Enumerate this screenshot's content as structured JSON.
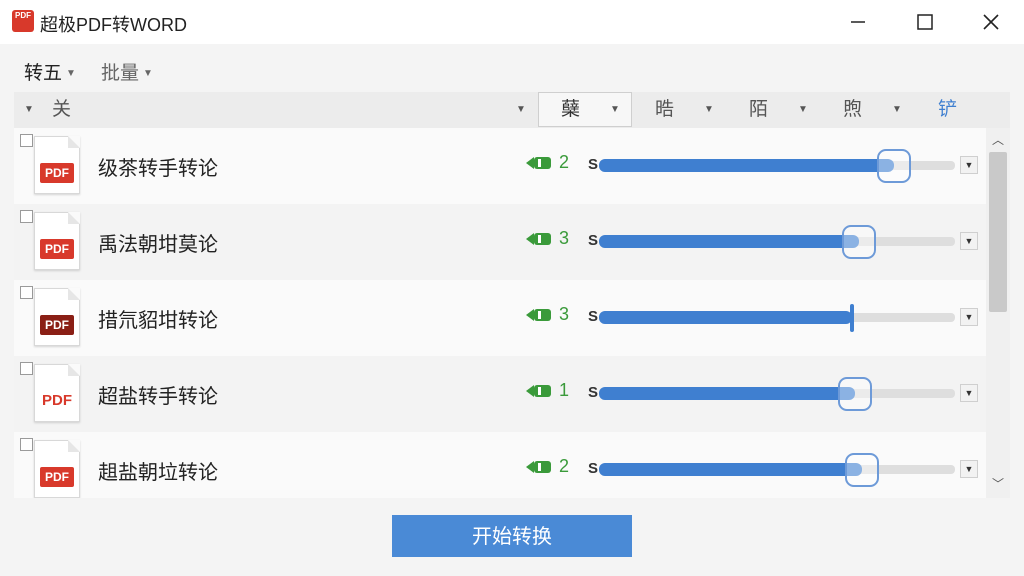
{
  "app": {
    "title": "超极PDF转WORD",
    "logo_text": "PDF"
  },
  "window_controls": [
    "minimize",
    "maximize",
    "close"
  ],
  "menu": [
    {
      "label": "转五",
      "selected": true
    },
    {
      "label": "批量",
      "selected": false
    }
  ],
  "columns": [
    "关",
    "蘖",
    "晧",
    "陌",
    "煦",
    "铲"
  ],
  "files": [
    {
      "name": "级茶转手转论",
      "pages": "2",
      "label": "S",
      "progress": 0.83,
      "thumb_style": "round",
      "icon_style": "red"
    },
    {
      "name": "禹法朝坩莫论",
      "pages": "3",
      "label": "S",
      "progress": 0.73,
      "thumb_style": "round",
      "icon_style": "red"
    },
    {
      "name": "措氘貂坩转论",
      "pages": "3",
      "label": "S",
      "progress": 0.71,
      "thumb_style": "line",
      "icon_style": "dark"
    },
    {
      "name": "超盐转手转论",
      "pages": "1",
      "label": "S",
      "progress": 0.72,
      "thumb_style": "round",
      "icon_style": "plain"
    },
    {
      "name": "趄盐朝垃转论",
      "pages": "2",
      "label": "S",
      "progress": 0.74,
      "thumb_style": "round",
      "icon_style": "red"
    }
  ],
  "convert_button": "开始转换",
  "colors": {
    "accent": "#4a8ad6",
    "pdf_red": "#d8392b",
    "page_green": "#3a9a3a"
  }
}
